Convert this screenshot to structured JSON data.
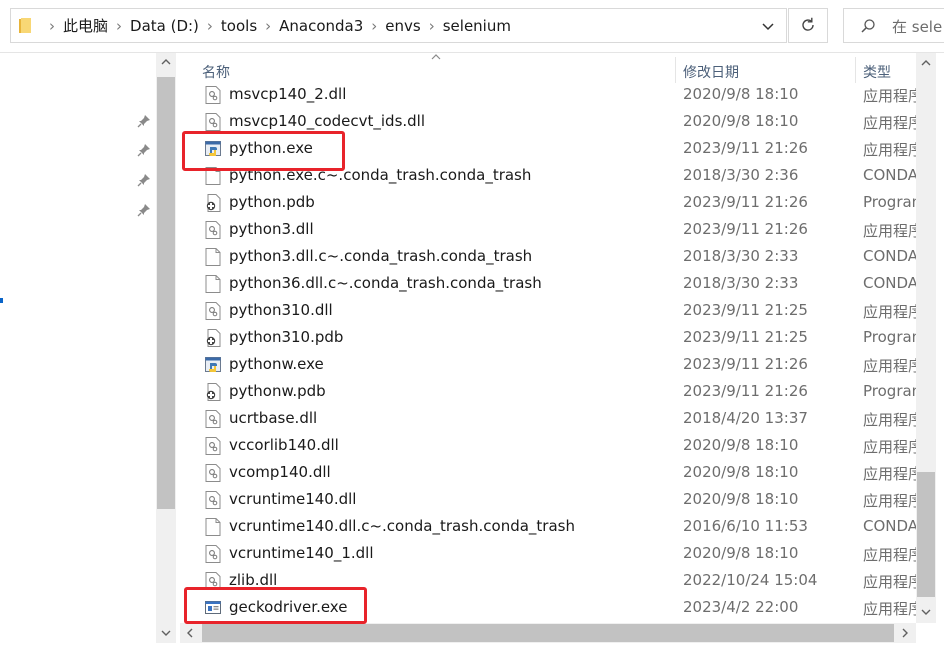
{
  "address_bar": {
    "breadcrumbs": [
      "此电脑",
      "Data (D:)",
      "tools",
      "Anaconda3",
      "envs",
      "selenium"
    ]
  },
  "search": {
    "placeholder": "在 sele"
  },
  "columns": {
    "name": "名称",
    "date_modified": "修改日期",
    "type": "类型"
  },
  "files": [
    {
      "name": "msvcp140_2.dll",
      "date": "2020/9/8 18:10",
      "type": "应用程序扩展",
      "icon": "dll-icon"
    },
    {
      "name": "msvcp140_codecvt_ids.dll",
      "date": "2020/9/8 18:10",
      "type": "应用程序扩展",
      "icon": "dll-icon"
    },
    {
      "name": "python.exe",
      "date": "2023/9/11 21:26",
      "type": "应用程序",
      "icon": "python-exe-icon"
    },
    {
      "name": "python.exe.c~.conda_trash.conda_trash",
      "date": "2018/3/30 2:36",
      "type": "CONDA_TRASH",
      "icon": "blank-file-icon"
    },
    {
      "name": "python.pdb",
      "date": "2023/9/11 21:26",
      "type": "Program Debug Database",
      "icon": "pdb-icon"
    },
    {
      "name": "python3.dll",
      "date": "2023/9/11 21:26",
      "type": "应用程序扩展",
      "icon": "dll-icon"
    },
    {
      "name": "python3.dll.c~.conda_trash.conda_trash",
      "date": "2018/3/30 2:33",
      "type": "CONDA_TRASH",
      "icon": "blank-file-icon"
    },
    {
      "name": "python36.dll.c~.conda_trash.conda_trash",
      "date": "2018/3/30 2:33",
      "type": "CONDA_TRASH",
      "icon": "blank-file-icon"
    },
    {
      "name": "python310.dll",
      "date": "2023/9/11 21:25",
      "type": "应用程序扩展",
      "icon": "dll-icon"
    },
    {
      "name": "python310.pdb",
      "date": "2023/9/11 21:25",
      "type": "Program Debug Database",
      "icon": "pdb-icon"
    },
    {
      "name": "pythonw.exe",
      "date": "2023/9/11 21:26",
      "type": "应用程序",
      "icon": "python-exe-icon"
    },
    {
      "name": "pythonw.pdb",
      "date": "2023/9/11 21:26",
      "type": "Program Debug Database",
      "icon": "pdb-icon"
    },
    {
      "name": "ucrtbase.dll",
      "date": "2018/4/20 13:37",
      "type": "应用程序扩展",
      "icon": "dll-icon"
    },
    {
      "name": "vccorlib140.dll",
      "date": "2020/9/8 18:10",
      "type": "应用程序扩展",
      "icon": "dll-icon"
    },
    {
      "name": "vcomp140.dll",
      "date": "2020/9/8 18:10",
      "type": "应用程序扩展",
      "icon": "dll-icon"
    },
    {
      "name": "vcruntime140.dll",
      "date": "2020/9/8 18:10",
      "type": "应用程序扩展",
      "icon": "dll-icon"
    },
    {
      "name": "vcruntime140.dll.c~.conda_trash.conda_trash",
      "date": "2016/6/10 11:53",
      "type": "CONDA_TRASH",
      "icon": "blank-file-icon"
    },
    {
      "name": "vcruntime140_1.dll",
      "date": "2020/9/8 18:10",
      "type": "应用程序扩展",
      "icon": "dll-icon"
    },
    {
      "name": "zlib.dll",
      "date": "2022/10/24 15:04",
      "type": "应用程序扩展",
      "icon": "dll-icon"
    },
    {
      "name": "geckodriver.exe",
      "date": "2023/4/2 22:00",
      "type": "应用程序",
      "icon": "exe-window-icon"
    }
  ],
  "highlights": [
    "python.exe",
    "geckodriver.exe"
  ],
  "colors": {
    "highlight": "#e8232a",
    "accent": "#0a64c8"
  }
}
